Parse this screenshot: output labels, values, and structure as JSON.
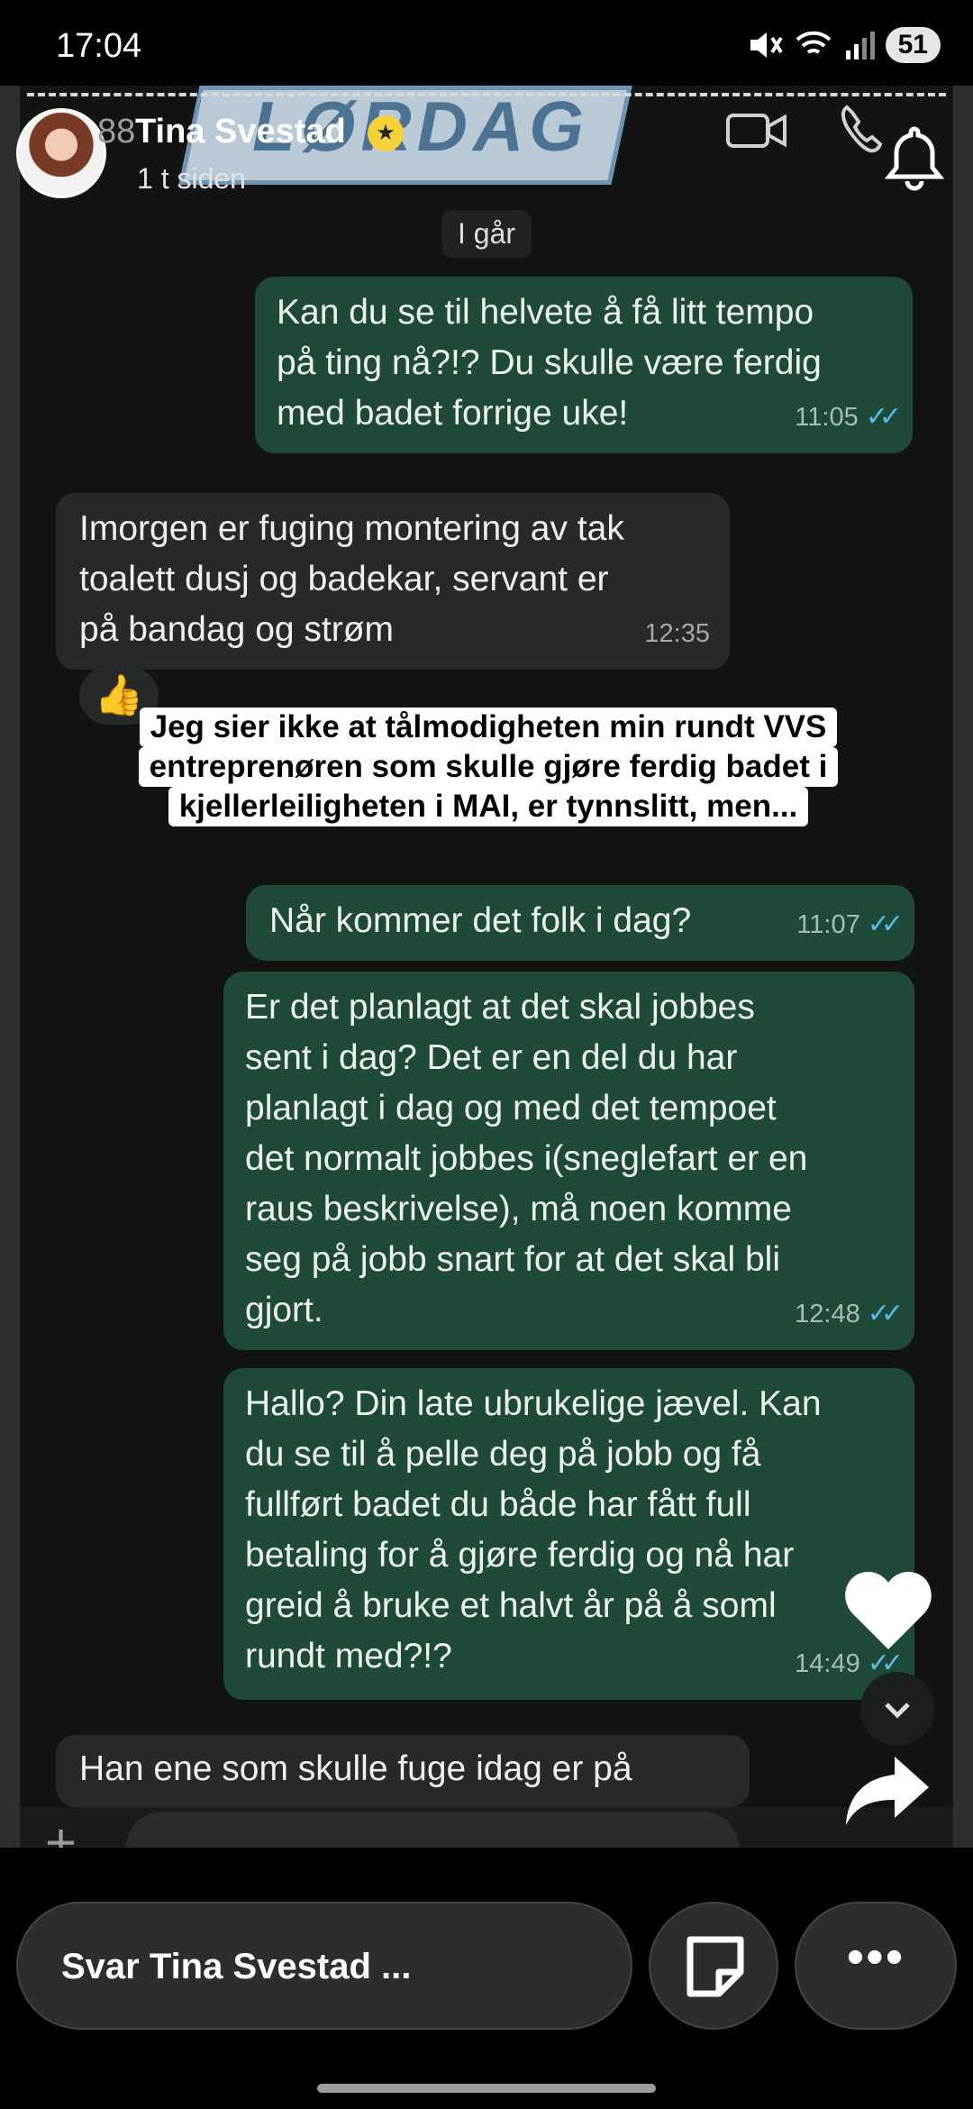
{
  "status_bar": {
    "time": "17:04",
    "battery": "51",
    "icons": [
      "mute-icon",
      "wifi-icon",
      "signal-icon",
      "battery-icon"
    ]
  },
  "story": {
    "banner_text": "LØRDAG",
    "avatar_prefix": "88",
    "user_name": "Tina Svestad",
    "posted": "1 t siden",
    "badge_icon": "star-icon"
  },
  "chat": {
    "date_chip": "I går",
    "messages": [
      {
        "dir": "out",
        "text": "Kan du se til helvete å få litt tempo\npå ting nå?!? Du skulle være ferdig\nmed badet forrige uke!",
        "time": "11:05"
      },
      {
        "dir": "in",
        "text": "Imorgen er fuging montering av tak\ntoalett dusj og badekar, servant er\npå bandag og strøm",
        "time": "12:35"
      },
      {
        "dir": "out",
        "text": "Når kommer det folk i dag?",
        "time": "11:07"
      },
      {
        "dir": "out",
        "text": "Er det planlagt at det skal jobbes\nsent i dag? Det er en del du har\nplanlagt i dag og med det tempoet\ndet normalt jobbes i(sneglefart er en\nraus beskrivelse), må noen komme\nseg på jobb snart for at det skal bli\ngjort.",
        "time": "12:48"
      },
      {
        "dir": "out",
        "text": "Hallo? Din late ubrukelige jævel. Kan\ndu se til å pelle deg på jobb og få\nfullført badet du både har fått full\nbetaling for å gjøre ferdig og nå har\ngreid å bruke et halvt år på å soml\nrundt med?!?",
        "time": "14:49"
      },
      {
        "dir": "in",
        "text": "Han ene som skulle fuge idag er på",
        "time": ""
      }
    ],
    "reaction": "👍"
  },
  "caption": {
    "lines": [
      "Jeg sier ikke at tålmodigheten min rundt VVS",
      "entreprenøren som skulle gjøre ferdig badet i",
      "kjellerleiligheten i MAI, er tynnslitt, men..."
    ]
  },
  "bottom_bar": {
    "reply_placeholder": "Svar Tina Svestad ...",
    "more_label": "•••"
  },
  "colors": {
    "outgoing_bubble": "#1e4a37",
    "incoming_bubble": "#262a28",
    "read_ticks": "#53bdeb"
  }
}
